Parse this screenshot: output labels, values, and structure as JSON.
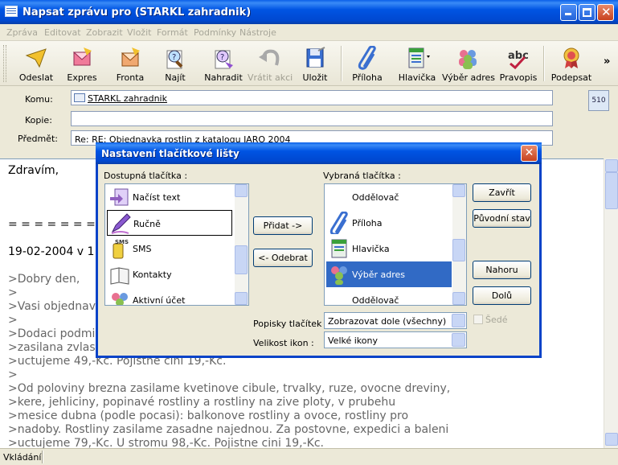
{
  "window": {
    "title": "Napsat zprávu pro (STARKL zahradnik)"
  },
  "menu": [
    "Zpráva",
    "Editovat",
    "Zobrazit",
    "Vložit",
    "Formát",
    "Podmínky",
    "Nástroje"
  ],
  "toolbar": {
    "buttons": [
      {
        "label": "Odeslat",
        "icon": "send-icon"
      },
      {
        "label": "Expres",
        "icon": "express-icon"
      },
      {
        "label": "Fronta",
        "icon": "queue-icon"
      },
      {
        "label": "Najít",
        "icon": "find-icon"
      },
      {
        "label": "Nahradit",
        "icon": "replace-icon"
      },
      {
        "label": "Vrátit akci",
        "icon": "undo-icon"
      },
      {
        "label": "Uložit",
        "icon": "save-icon"
      },
      {
        "label": "Příloha",
        "icon": "paperclip-icon"
      },
      {
        "label": "Hlavička",
        "icon": "header-icon"
      },
      {
        "label": "Výběr adres",
        "icon": "address-book-icon"
      },
      {
        "label": "Pravopis",
        "icon": "spellcheck-icon"
      },
      {
        "label": "Podepsat",
        "icon": "sign-icon"
      }
    ],
    "more": "»"
  },
  "header": {
    "to_label": "Komu:",
    "to_value": "STARKL zahradnik",
    "cc_label": "Kopie:",
    "cc_value": "",
    "subject_label": "Předmět:",
    "subject_value": "Re: RE: Objednavka rostlin z katalogu JARO 2004",
    "badge": "510"
  },
  "body": {
    "lines": [
      "Zdravím,",
      "= = = = = = = = =",
      "19-02-2004 v 11:",
      ">Dobry den,",
      ">",
      ">Vasi objednavku",
      ">",
      ">Dodaci podmin",
      ">zasilana zvlast",
      ">uctujeme 49,-Kc. Pojistne cini 19,-Kc.",
      ">",
      ">Od poloviny brezna zasilame kvetinove cibule, trvalky, ruze, ovocne dreviny,",
      ">kere, jehliciny, popinavé rostliny a rostliny na zive ploty, v prubehu",
      ">mesice dubna (podle pocasi): balkonove rostliny a ovoce, rostliny pro",
      ">nadoby. Rostliny zasilame zasadne najednou. Za postovne, expedici a baleni",
      ">uctujeme 79,-Kc. U stromu 98,-Kc. Pojistne cini 19,-Kc."
    ]
  },
  "status": "Vkládání",
  "dialog": {
    "title": "Nastavení tlačítkové lišty",
    "available_label": "Dostupná tlačítka :",
    "available_items": [
      {
        "label": "Načíst text",
        "icon": "load-text-icon"
      },
      {
        "label": "Ručně",
        "icon": "pen-icon"
      },
      {
        "label": "SMS",
        "icon": "sms-icon"
      },
      {
        "label": "Kontakty",
        "icon": "contacts-icon"
      },
      {
        "label": "Aktivní účet",
        "icon": "active-account-icon"
      }
    ],
    "selected_label": "Vybraná tlačítka :",
    "selected_items": [
      {
        "label": "Oddělovač",
        "icon": ""
      },
      {
        "label": "Příloha",
        "icon": "paperclip-icon"
      },
      {
        "label": "Hlavička",
        "icon": "header-icon"
      },
      {
        "label": "Výběr adres",
        "icon": "address-book-icon"
      },
      {
        "label": "Oddělovač",
        "icon": ""
      }
    ],
    "add_button": "Přidat ->",
    "remove_button": "<- Odebrat",
    "close_button": "Zavřít",
    "default_button": "Původní stav",
    "up_button": "Nahoru",
    "down_button": "Dolů",
    "captions_label": "Popisky tlačítek :",
    "captions_value": "Zobrazovat dole (všechny)",
    "gray_label": "Šedé",
    "icon_size_label": "Velikost ikon :",
    "icon_size_value": "Velké ikony"
  }
}
